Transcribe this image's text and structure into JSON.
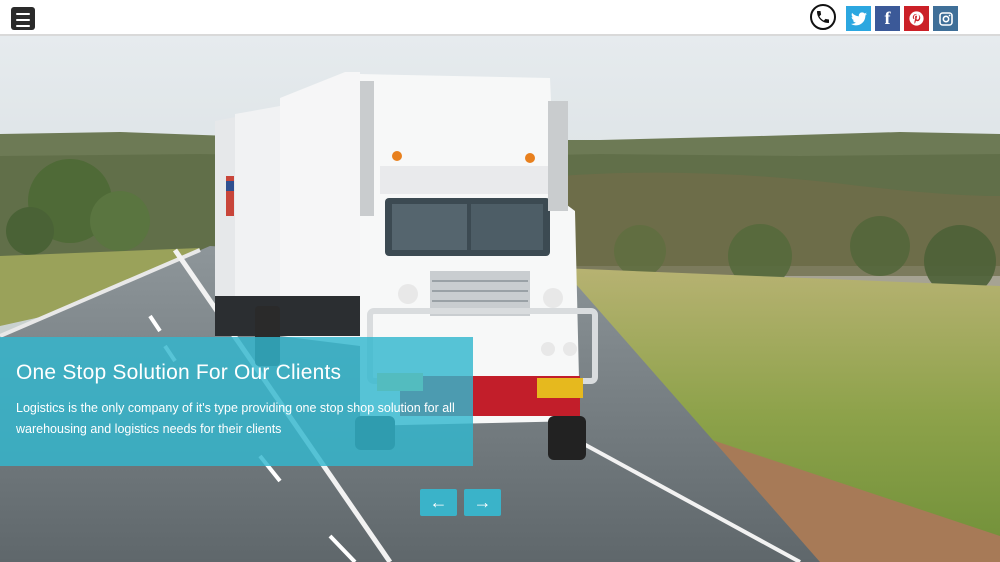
{
  "header": {
    "menu_icon": "hamburger-icon",
    "phone_icon": "phone-icon",
    "social": [
      {
        "name": "twitter-icon",
        "color": "#2ca7e0"
      },
      {
        "name": "facebook-icon",
        "color": "#3b5998"
      },
      {
        "name": "pinterest-icon",
        "color": "#cb2027"
      },
      {
        "name": "instagram-icon",
        "color": "#3f6f98"
      }
    ]
  },
  "hero": {
    "title": "One Stop Solution For Our Clients",
    "text": "Logistics is the only company of it's type providing one stop shop solution for all warehousing and logistics needs for their clients",
    "prev_glyph": "←",
    "next_glyph": "→",
    "accent": "#3ab3c9"
  }
}
